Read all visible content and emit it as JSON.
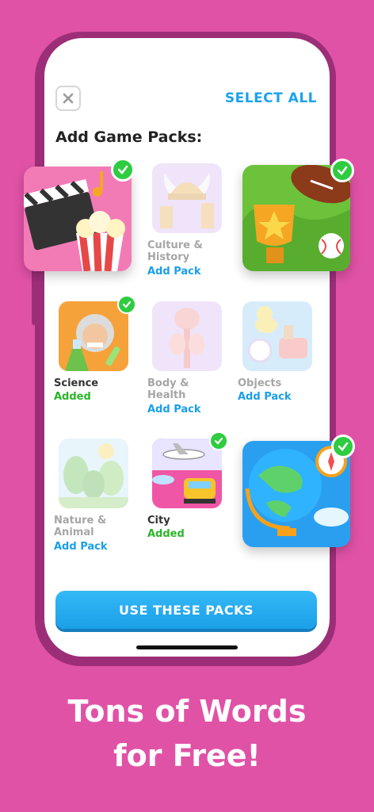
{
  "header": {
    "close_icon": "close-icon",
    "select_all_label": "SELECT ALL",
    "title": "Add Game Packs:"
  },
  "packs": [
    {
      "name": "Movies",
      "label": "",
      "status": "",
      "selected": true,
      "icon": "clapperboard-popcorn"
    },
    {
      "name": "Culture & History",
      "label": "Culture &\nHistory",
      "status": "Add Pack",
      "selected": false,
      "icon": "viking-helmet-columns"
    },
    {
      "name": "Sports",
      "label": "",
      "status": "",
      "selected": true,
      "icon": "trophy-football"
    },
    {
      "name": "Science",
      "label": "Science",
      "status": "Added",
      "selected": true,
      "icon": "scientist-flask"
    },
    {
      "name": "Body & Health",
      "label": "Body &\nHealth",
      "status": "Add Pack",
      "selected": false,
      "icon": "anatomy-body"
    },
    {
      "name": "Objects",
      "label": "Objects",
      "status": "Add Pack",
      "selected": false,
      "icon": "duck-clock-toaster"
    },
    {
      "name": "Nature & Animal",
      "label": "Nature &\nAnimal",
      "status": "Add Pack",
      "selected": false,
      "icon": "forest-trees"
    },
    {
      "name": "City",
      "label": "City",
      "status": "Added",
      "selected": true,
      "icon": "taxi-airplane"
    },
    {
      "name": "Geography",
      "label": "",
      "status": "",
      "selected": true,
      "icon": "globe-compass"
    }
  ],
  "cta": {
    "label": "USE THESE PACKS"
  },
  "caption": {
    "line1": "Tons of Words",
    "line2": "for Free!"
  },
  "colors": {
    "background": "#e052a6",
    "accent_blue": "#1aa3f0",
    "added_green": "#2bb52b",
    "check_green": "#2ecc40"
  }
}
